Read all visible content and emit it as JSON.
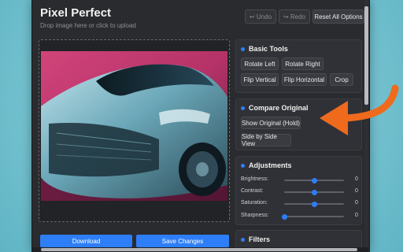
{
  "app": {
    "title": "Pixel Perfect",
    "subtitle": "Drop image here or click to upload"
  },
  "toolbar": {
    "undo": "↩ Undo",
    "redo": "↪ Redo",
    "reset": "Reset All Options"
  },
  "actions": {
    "download": "Download",
    "save": "Save Changes"
  },
  "basic_tools": {
    "title": "Basic Tools",
    "buttons": [
      "Rotate Left",
      "Rotate Right",
      "Flip Vertical",
      "Flip Horizontal",
      "Crop"
    ]
  },
  "compare": {
    "title": "Compare Original",
    "buttons": [
      "Show Original (Hold)",
      "Side by Side View"
    ]
  },
  "adjustments": {
    "title": "Adjustments",
    "sliders": [
      {
        "label": "Brightness:",
        "value": "0",
        "level": 0.5
      },
      {
        "label": "Contrast:",
        "value": "0",
        "level": 0.5
      },
      {
        "label": "Saturation:",
        "value": "0",
        "level": 0.5
      },
      {
        "label": "Sharpness:",
        "value": "0",
        "level": 0.0
      }
    ]
  },
  "filters": {
    "title": "Filters"
  },
  "colors": {
    "accent": "#2d7ef7",
    "arrow": "#ef6a1c"
  }
}
